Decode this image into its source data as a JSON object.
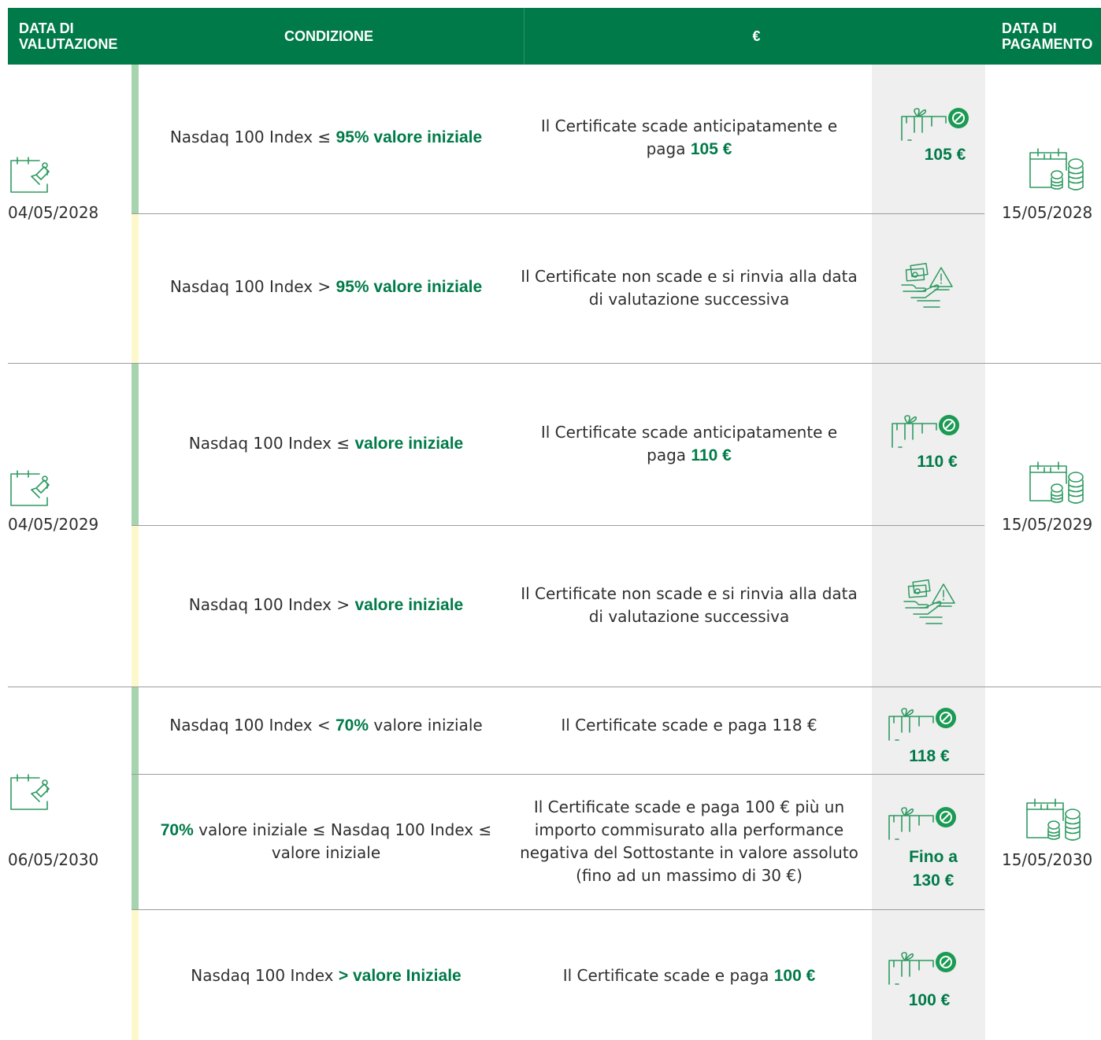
{
  "header": {
    "date_label": "DATA DI VALUTAZIONE",
    "condition_label": "CONDIZIONE",
    "euro_label": "€",
    "pay_label": "DATA DI PAGAMENTO"
  },
  "periods": [
    {
      "eval_date": "04/05/2028",
      "pay_date": "15/05/2028",
      "rows": [
        {
          "cond_pre": "Nasdaq 100 Index ≤ ",
          "cond_bold": "95% valore iniziale",
          "desc_pre": "Il Certificate scade anticipatamente e paga ",
          "desc_bold": "105 €",
          "amount": "105 €",
          "icon": "gift-check-icon"
        },
        {
          "cond_pre": "Nasdaq 100 Index > ",
          "cond_bold": "95% valore iniziale",
          "desc": "Il Certificate non scade e si rinvia alla data di valutazione successiva",
          "icon": "hand-money-warning-icon"
        }
      ]
    },
    {
      "eval_date": "04/05/2029",
      "pay_date": "15/05/2029",
      "rows": [
        {
          "cond_pre": "Nasdaq 100 Index ≤ ",
          "cond_bold": "valore iniziale",
          "desc_pre": "Il Certificate scade anticipatamente e paga ",
          "desc_bold": "110 €",
          "amount": "110 €",
          "icon": "gift-check-icon"
        },
        {
          "cond_pre": "Nasdaq 100 Index > ",
          "cond_bold": "valore iniziale",
          "desc": "Il Certificate non scade e si rinvia alla data di valutazione successiva",
          "icon": "hand-money-warning-icon"
        }
      ]
    },
    {
      "eval_date": "06/05/2030",
      "pay_date": "15/05/2030",
      "rows": [
        {
          "cond_pre": "Nasdaq 100 Index < ",
          "cond_bold": "70%",
          "cond_post": " valore iniziale",
          "desc": "Il Certificate scade e paga 118 €",
          "amount": "118 €",
          "icon": "gift-check-icon"
        },
        {
          "cond_bold": "70%",
          "cond_post": " valore iniziale ≤ Nasdaq 100 Index ≤  valore iniziale",
          "desc": "Il Certificate scade e paga 100 € più un importo commisurato alla performance negativa del Sottostante in valore assoluto (fino ad un massimo di 30 €)",
          "amount_line1": "Fino a",
          "amount_line2": "130 €",
          "icon": "gift-check-icon"
        },
        {
          "cond_pre": "Nasdaq 100 Index ",
          "cond_bold": "> valore Iniziale",
          "desc_pre": "Il Certificate scade e paga ",
          "desc_bold": "100 €",
          "amount": "100 €",
          "icon": "gift-check-icon"
        }
      ]
    }
  ],
  "colors": {
    "brand_green": "#007a48",
    "bar_green": "#a6d4ae",
    "bar_yellow": "#fdf8cc",
    "gray_column": "#efefef"
  }
}
